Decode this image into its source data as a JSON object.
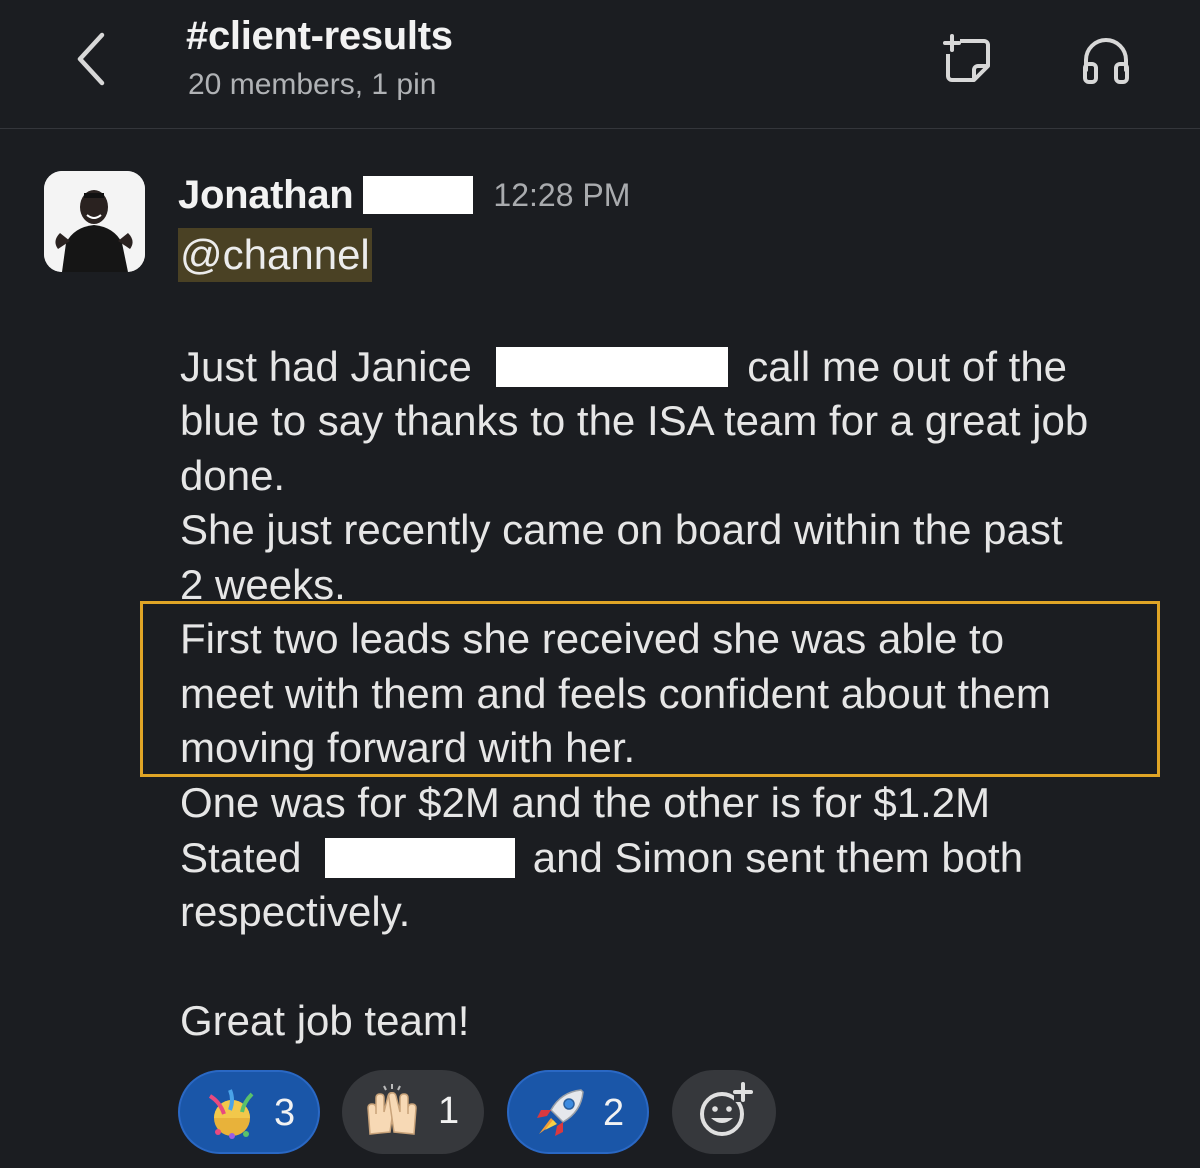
{
  "header": {
    "channel_name": "#client-results",
    "channel_meta": "20 members, 1 pin"
  },
  "message": {
    "author": "Jonathan",
    "time": "12:28 PM",
    "mention": "@channel",
    "lines": [
      {
        "segments": [
          "Just had Janice",
          "call me out of the"
        ]
      },
      {
        "text": "blue to say thanks to the ISA team for a great job"
      },
      {
        "text": "done."
      },
      {
        "text": "She just recently came on board within the past"
      },
      {
        "text": "2 weeks."
      },
      {
        "text": "First two leads she received she was able to"
      },
      {
        "text": "meet with them and feels confident about them"
      },
      {
        "text": "moving forward with her."
      },
      {
        "text": "One was for $2M and the other is for $1.2M"
      },
      {
        "segments": [
          "Stated",
          "and Simon sent them both"
        ]
      },
      {
        "text": "respectively."
      },
      {
        "text": "Great job team!"
      }
    ]
  },
  "reactions": [
    {
      "emoji": "confetti-ball",
      "count": "3",
      "selected": true
    },
    {
      "emoji": "raising-hands",
      "count": "1",
      "selected": false
    },
    {
      "emoji": "rocket",
      "count": "2",
      "selected": true
    },
    {
      "emoji": "add-reaction-icon",
      "count": "",
      "selected": false
    }
  ],
  "colors": {
    "background": "#1b1d21",
    "highlight_border": "#e0a526",
    "mention_bg": "#4a4124",
    "reaction_selected": "#1a56a8"
  }
}
